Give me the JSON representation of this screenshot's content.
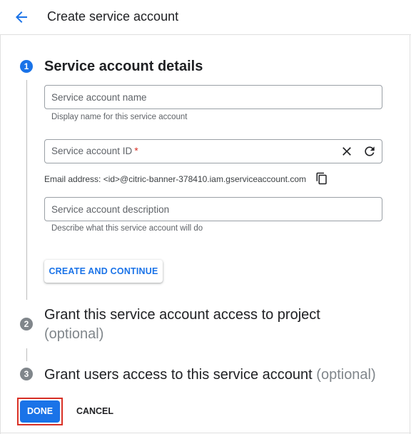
{
  "header": {
    "title": "Create service account",
    "back_icon": "arrow-back-icon"
  },
  "steps": [
    {
      "number": "1",
      "title": "Service account details",
      "state": "active",
      "fields": {
        "name": {
          "placeholder": "Service account name",
          "value": "",
          "hint": "Display name for this service account"
        },
        "id": {
          "label": "Service account ID",
          "required_mark": "*",
          "value": "",
          "clear_icon": "close-icon",
          "refresh_icon": "refresh-icon"
        },
        "email": {
          "text": "Email address: <id>@citric-banner-378410.iam.gserviceaccount.com",
          "copy_icon": "copy-icon"
        },
        "description": {
          "placeholder": "Service account description",
          "value": "",
          "hint": "Describe what this service account will do"
        }
      },
      "create_button": "CREATE AND CONTINUE"
    },
    {
      "number": "2",
      "title": "Grant this service account access to project",
      "optional": "(optional)",
      "state": "inactive"
    },
    {
      "number": "3",
      "title": "Grant users access to this service account",
      "optional": "(optional)",
      "state": "inactive"
    }
  ],
  "footer": {
    "done_label": "DONE",
    "cancel_label": "CANCEL"
  },
  "colors": {
    "accent": "#1a73e8",
    "required": "#d93025",
    "inactive_step": "#80868b",
    "highlight_border": "#d93025"
  }
}
